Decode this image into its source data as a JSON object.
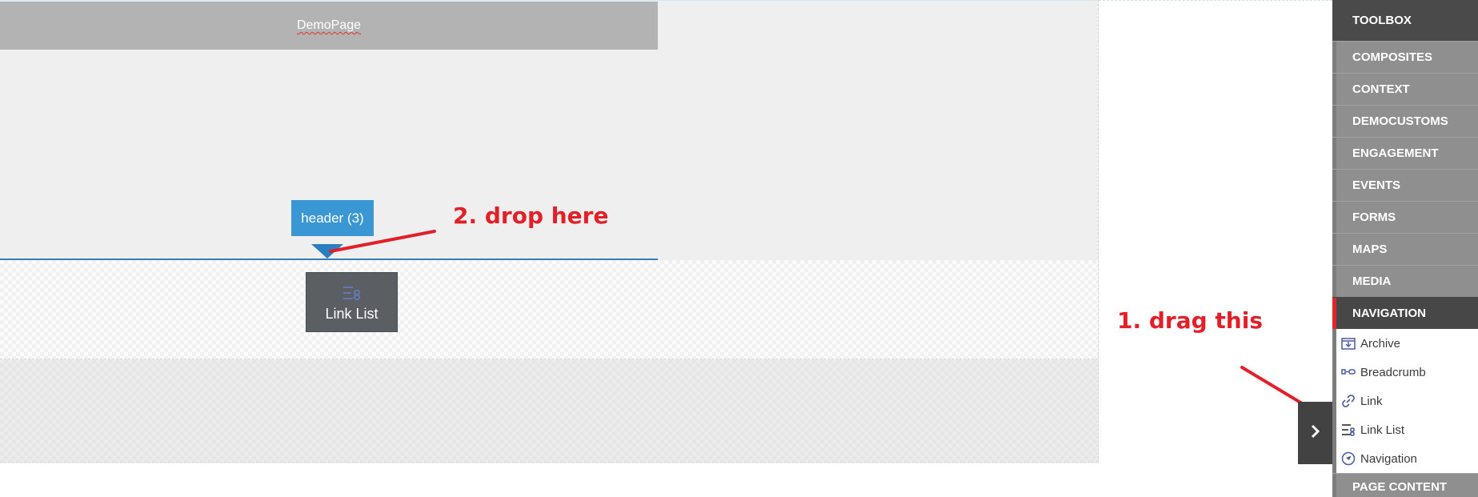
{
  "page": {
    "title": "DemoPage"
  },
  "placeholder": {
    "tag_label": "header (3)"
  },
  "drag_ghost": {
    "label": "Link List",
    "icon": "link-list-icon"
  },
  "annotations": {
    "drop": "2. drop here",
    "drag": "1. drag this",
    "color": "#e3202a"
  },
  "toolbox": {
    "title": "TOOLBOX",
    "categories": [
      {
        "label": "COMPOSITES"
      },
      {
        "label": "CONTEXT"
      },
      {
        "label": "DEMOCUSTOMS"
      },
      {
        "label": "ENGAGEMENT"
      },
      {
        "label": "EVENTS"
      },
      {
        "label": "FORMS"
      },
      {
        "label": "MAPS"
      },
      {
        "label": "MEDIA"
      },
      {
        "label": "NAVIGATION",
        "active": true
      }
    ],
    "navigation_items": [
      {
        "label": "Archive",
        "icon": "archive-icon"
      },
      {
        "label": "Breadcrumb",
        "icon": "breadcrumb-icon"
      },
      {
        "label": "Link",
        "icon": "link-icon"
      },
      {
        "label": "Link List",
        "icon": "link-list-icon"
      },
      {
        "label": "Navigation",
        "icon": "navigation-icon"
      }
    ],
    "next_category": "PAGE CONTENT"
  },
  "colors": {
    "accent": "#3a97d4",
    "active_marker": "#e0262b",
    "toolbox_bg": "#8f8f8f",
    "toolbox_dark": "#4a4a4a"
  }
}
